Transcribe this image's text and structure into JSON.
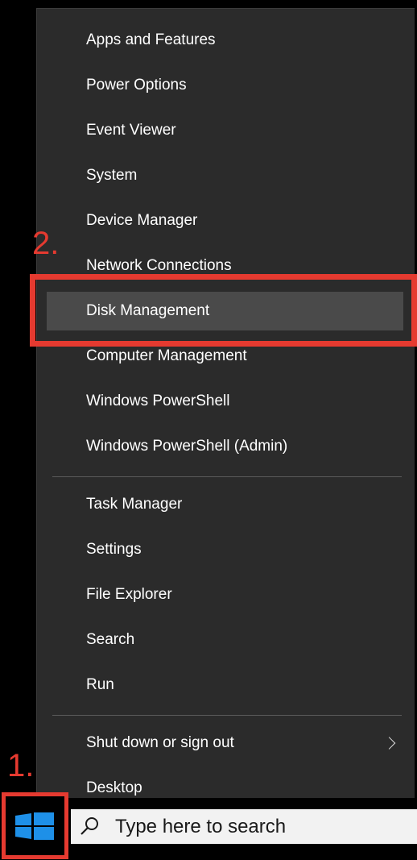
{
  "menu": {
    "group1": [
      {
        "label": "Apps and Features"
      },
      {
        "label": "Power Options"
      },
      {
        "label": "Event Viewer"
      },
      {
        "label": "System"
      },
      {
        "label": "Device Manager"
      },
      {
        "label": "Network Connections"
      },
      {
        "label": "Disk Management",
        "highlighted": true
      },
      {
        "label": "Computer Management"
      },
      {
        "label": "Windows PowerShell"
      },
      {
        "label": "Windows PowerShell (Admin)"
      }
    ],
    "group2": [
      {
        "label": "Task Manager"
      },
      {
        "label": "Settings"
      },
      {
        "label": "File Explorer"
      },
      {
        "label": "Search"
      },
      {
        "label": "Run"
      }
    ],
    "group3": [
      {
        "label": "Shut down or sign out",
        "has_submenu": true
      },
      {
        "label": "Desktop"
      }
    ]
  },
  "taskbar": {
    "search_placeholder": "Type here to search",
    "start_icon": "windows-logo-icon",
    "search_icon": "search-icon"
  },
  "annotations": {
    "step1": "1.",
    "step2": "2.",
    "color": "#e53a30"
  },
  "colors": {
    "menu_bg": "#2b2b2b",
    "highlight_bg": "#4a4a4a",
    "windows_blue": "#1e90e8"
  }
}
